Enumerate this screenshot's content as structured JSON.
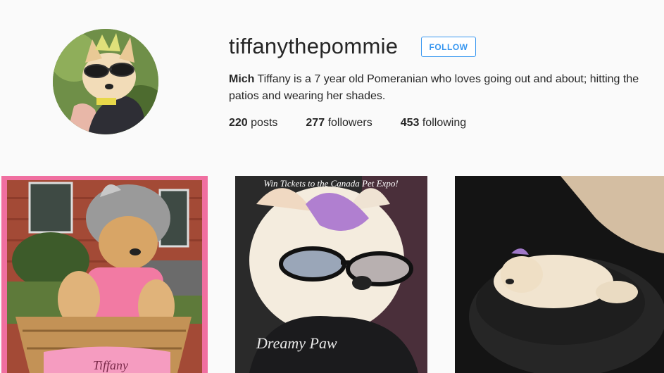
{
  "profile": {
    "username": "tiffanythepommie",
    "follow_label": "FOLLOW",
    "full_name": "Mich",
    "bio": "Tiffany is a 7 year old Pomeranian who loves going out and about; hitting the patios and wearing her shades.",
    "avatar_icon": "profile-photo"
  },
  "stats": {
    "posts_count": "220",
    "posts_label": "posts",
    "followers_count": "277",
    "followers_label": "followers",
    "following_count": "453",
    "following_label": "following"
  },
  "posts": [
    {
      "image": "dog-in-basket-photo",
      "caption_text": "Tiffany"
    },
    {
      "image": "dog-with-sunglasses-photo",
      "banner_text": "Win Tickets to the Canada Pet Expo!",
      "shirt_text": "Dreamy Paw"
    },
    {
      "image": "dog-lying-on-seat-photo"
    }
  ],
  "colors": {
    "follow_blue": "#3897f0",
    "text": "#262626",
    "background": "#fafafa"
  }
}
